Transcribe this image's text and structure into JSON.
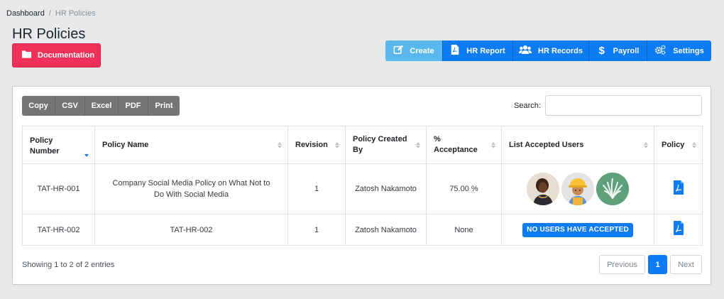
{
  "breadcrumb": {
    "home": "Dashboard",
    "separator": "/",
    "current": "HR Policies"
  },
  "page": {
    "title": "HR Policies"
  },
  "documentation_button": {
    "label": "Documentation",
    "icon": "folder-icon",
    "color": "#f0325a"
  },
  "toolbar": [
    {
      "label": "Create",
      "icon": "edit-icon",
      "color": "#5ab8ef"
    },
    {
      "label": "HR Report",
      "icon": "pdf-file-icon",
      "color": "#0d7bf2"
    },
    {
      "label": "HR Records",
      "icon": "users-icon",
      "color": "#0d7bf2"
    },
    {
      "label": "Payroll",
      "icon": "dollar-icon",
      "color": "#0d7bf2"
    },
    {
      "label": "Settings",
      "icon": "cogs-icon",
      "color": "#0d7bf2"
    }
  ],
  "export_buttons": [
    "Copy",
    "CSV",
    "Excel",
    "PDF",
    "Print"
  ],
  "search": {
    "label": "Search:",
    "value": "",
    "placeholder": ""
  },
  "table": {
    "columns": [
      "Policy Number",
      "Policy Name",
      "Revision",
      "Policy Created By",
      "% Acceptance",
      "List Accepted Users",
      "Policy"
    ],
    "sorted_column": "Policy Number",
    "rows": [
      {
        "policy_number": "TAT-HR-001",
        "policy_name": "Company Social Media Policy on What Not to Do With Social Media",
        "revision": "1",
        "created_by": "Zatosh Nakamoto",
        "acceptance": "75.00 %",
        "accepted_users": [
          "woman-avatar",
          "construction-worker-avatar",
          "aloe-plant-avatar"
        ],
        "policy_icon": "pdf-file-icon"
      },
      {
        "policy_number": "TAT-HR-002",
        "policy_name": "TAT-HR-002",
        "revision": "1",
        "created_by": "Zatosh Nakamoto",
        "acceptance": "None",
        "accepted_users_badge": "NO USERS HAVE ACCEPTED",
        "policy_icon": "pdf-file-icon"
      }
    ]
  },
  "footer": {
    "info": "Showing 1 to 2 of 2 entries"
  },
  "pagination": {
    "previous": "Previous",
    "current": "1",
    "next": "Next"
  }
}
